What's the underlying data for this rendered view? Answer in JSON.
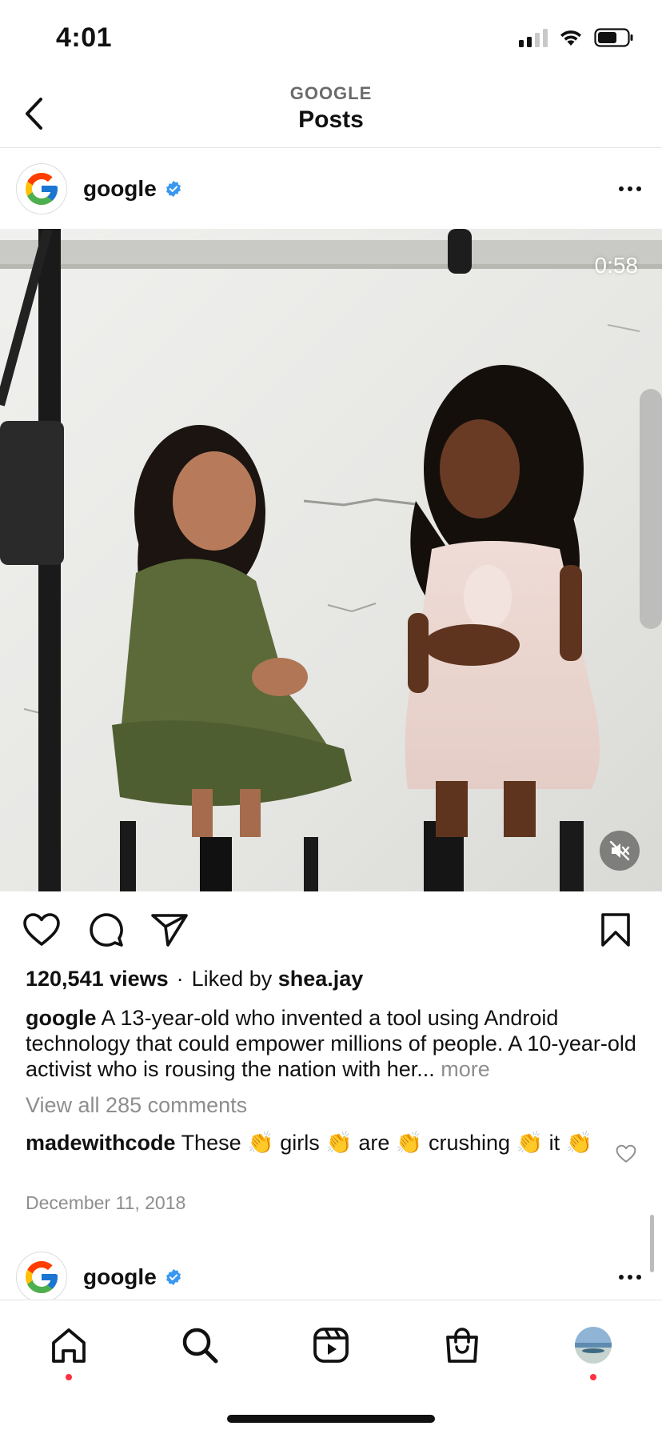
{
  "status_bar": {
    "time": "4:01"
  },
  "header": {
    "subtitle": "GOOGLE",
    "title": "Posts"
  },
  "post": {
    "username": "google",
    "duration": "0:58",
    "views": "120,541 views",
    "liked_by_prefix": "Liked by",
    "liked_by_user": "shea.jay",
    "caption_user": "google",
    "caption_text": "A 13-year-old who invented a tool using Android technology that could empower millions of people. A 10-year-old activist who is rousing the nation with her...",
    "caption_more": "more",
    "view_comments": "View all 285 comments",
    "comment_user": "madewithcode",
    "comment_text": "These 👏 girls 👏 are 👏 crushing 👏 it 👏",
    "date": "December 11, 2018"
  },
  "next_post": {
    "username": "google"
  },
  "icons": {
    "back": "chevron-left-icon",
    "verified": "verified-badge-icon",
    "more": "more-horizontal-icon",
    "like": "heart-icon",
    "comment": "comment-icon",
    "share": "send-icon",
    "save": "bookmark-icon",
    "mute": "speaker-muted-icon",
    "tabs": [
      "home-icon",
      "search-icon",
      "reels-icon",
      "shop-icon",
      "profile-avatar"
    ]
  },
  "colors": {
    "verified": "#3897f0",
    "notification_dot": "#ff3040",
    "muted_text": "#8e8e8e"
  }
}
